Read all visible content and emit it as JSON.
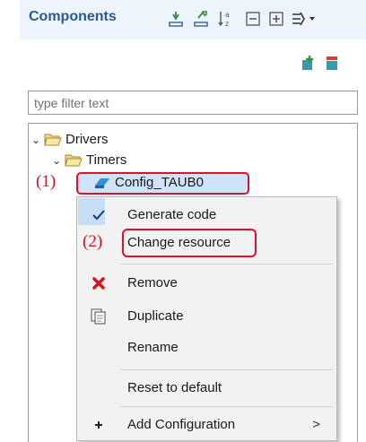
{
  "header": {
    "title": "Components"
  },
  "filter": {
    "placeholder": "type filter text"
  },
  "tree": {
    "drivers_label": "Drivers",
    "timers_label": "Timers",
    "config_label": "Config_TAUB0"
  },
  "callouts": {
    "one": "(1)",
    "two": "(2)"
  },
  "menu": {
    "generate_code": "Generate code",
    "change_resource": "Change resource",
    "remove": "Remove",
    "duplicate": "Duplicate",
    "rename": "Rename",
    "reset_default": "Reset to default",
    "add_configuration": "Add Configuration",
    "submenu_arrow": ">"
  },
  "colors": {
    "accent_red": "#e0102a",
    "title_blue": "#2a5a96",
    "selection_blue": "#cfe4fa"
  }
}
